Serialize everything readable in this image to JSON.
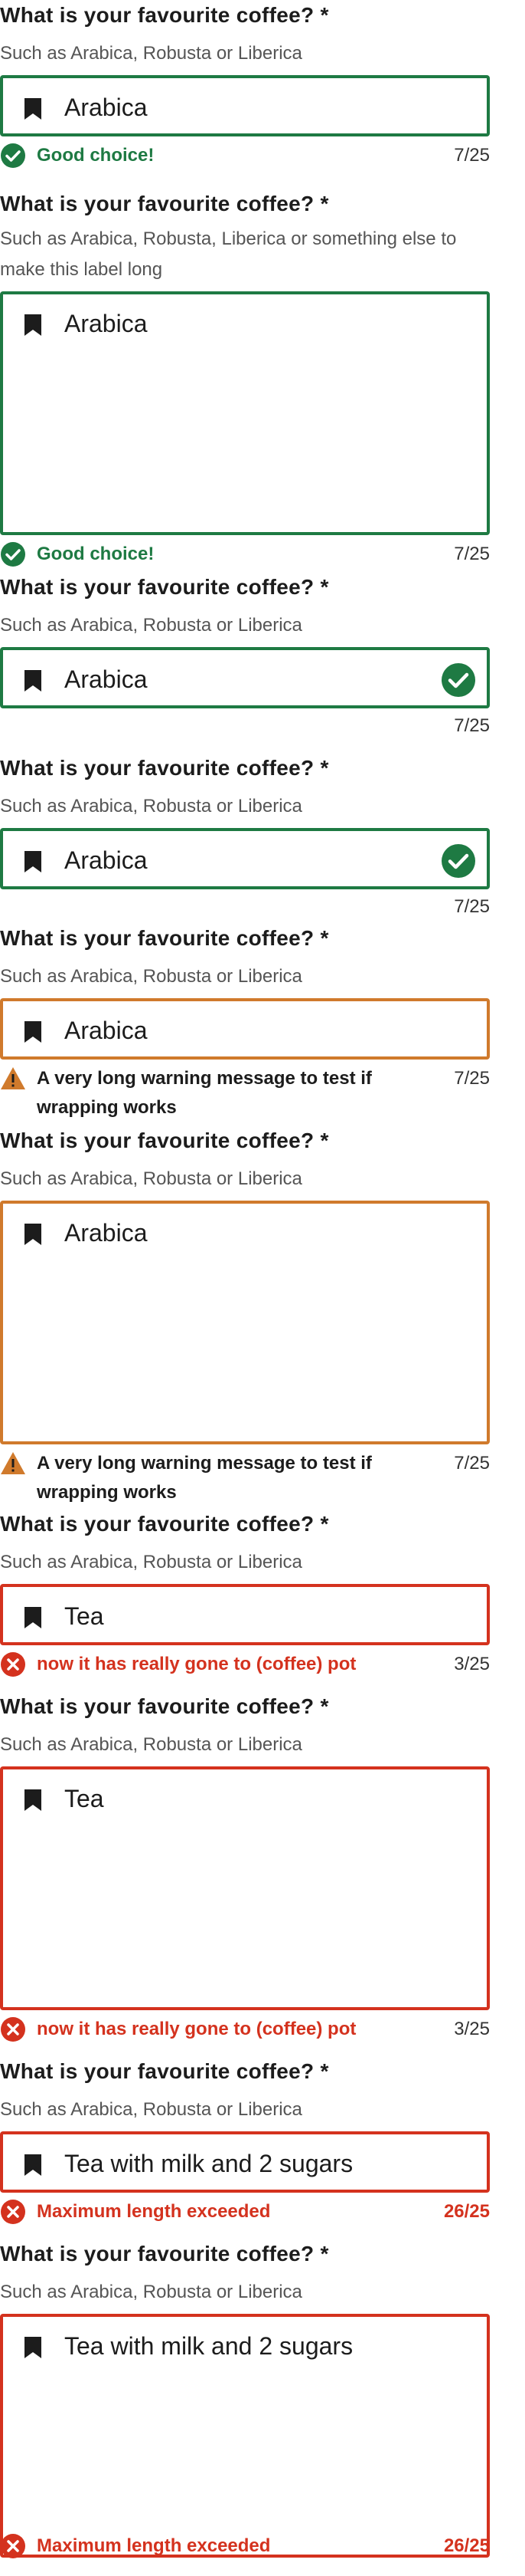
{
  "field_label": "What is your favourite coffee? *",
  "colors": {
    "success": "#1e7a43",
    "warning": "#d07a2c",
    "error": "#d4321e",
    "text": "#1c1c1c"
  },
  "icons": {
    "leading": "bookmark-icon",
    "success": "check-circle-icon",
    "warning": "warning-triangle-icon",
    "error": "error-circle-icon"
  },
  "fields": [
    {
      "label": "What is your favourite coffee? *",
      "hint": "Such as Arabica, Robusta or Liberica",
      "value": "Arabica",
      "state": "success",
      "message": "Good choice!",
      "count": "7/25"
    },
    {
      "label": "What is your favourite coffee? *",
      "hint": "Such as Arabica, Robusta, Liberica or something else to make this label long",
      "value": "Arabica",
      "state": "success",
      "message": "Good choice!",
      "count": "7/25"
    },
    {
      "label": "What is your favourite coffee? *",
      "hint": "Such as Arabica, Robusta or Liberica",
      "value": "Arabica",
      "state": "success",
      "count": "7/25"
    },
    {
      "label": "What is your favourite coffee? *",
      "hint": "Such as Arabica, Robusta or Liberica",
      "value": "Arabica",
      "state": "success",
      "count": "7/25"
    },
    {
      "label": "What is your favourite coffee? *",
      "hint": "Such as Arabica, Robusta or Liberica",
      "value": "Arabica",
      "state": "warning",
      "message": "A very long warning message to test if wrapping works",
      "count": "7/25"
    },
    {
      "label": "What is your favourite coffee? *",
      "hint": "Such as Arabica, Robusta or Liberica",
      "value": "Arabica",
      "state": "warning",
      "message": "A very long warning message to test if wrapping works",
      "count": "7/25"
    },
    {
      "label": "What is your favourite coffee? *",
      "hint": "Such as Arabica, Robusta or Liberica",
      "value": "Tea",
      "state": "error",
      "message": "now it has really gone to (coffee) pot",
      "count": "3/25"
    },
    {
      "label": "What is your favourite coffee? *",
      "hint": "Such as Arabica, Robusta or Liberica",
      "value": "Tea",
      "state": "error",
      "message": "now it has really gone to (coffee) pot",
      "count": "3/25"
    },
    {
      "label": "What is your favourite coffee? *",
      "hint": "Such as Arabica, Robusta or Liberica",
      "value": "Tea with milk and 2 sugars",
      "state": "error",
      "message": "Maximum length exceeded",
      "count": "26/25"
    },
    {
      "label": "What is your favourite coffee? *",
      "hint": "Such as Arabica, Robusta or Liberica",
      "value": "Tea with milk and 2 sugars",
      "state": "error",
      "message": "Maximum length exceeded",
      "count": "26/25"
    }
  ]
}
